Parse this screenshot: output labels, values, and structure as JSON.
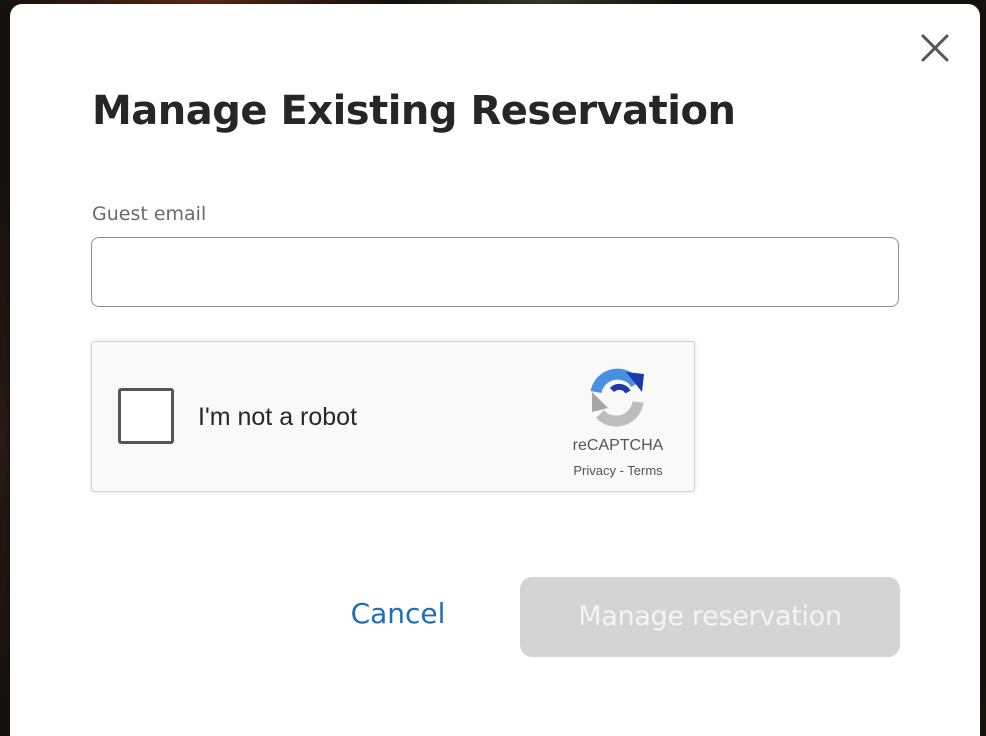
{
  "dialog": {
    "title": "Manage Existing Reservation",
    "close_icon": "close-icon"
  },
  "form": {
    "email_label": "Guest email",
    "email_value": "",
    "email_placeholder": ""
  },
  "recaptcha": {
    "checkbox_label": "I'm not a robot",
    "checked": false,
    "brand": "reCAPTCHA",
    "privacy_link": "Privacy",
    "separator": " - ",
    "terms_link": "Terms",
    "logo_icon": "recaptcha-logo-icon"
  },
  "actions": {
    "cancel_label": "Cancel",
    "submit_label": "Manage reservation",
    "submit_enabled": false
  },
  "colors": {
    "link_blue": "#1f6fb8",
    "disabled_button_bg": "#d4d4d4",
    "title_text": "#262626"
  }
}
